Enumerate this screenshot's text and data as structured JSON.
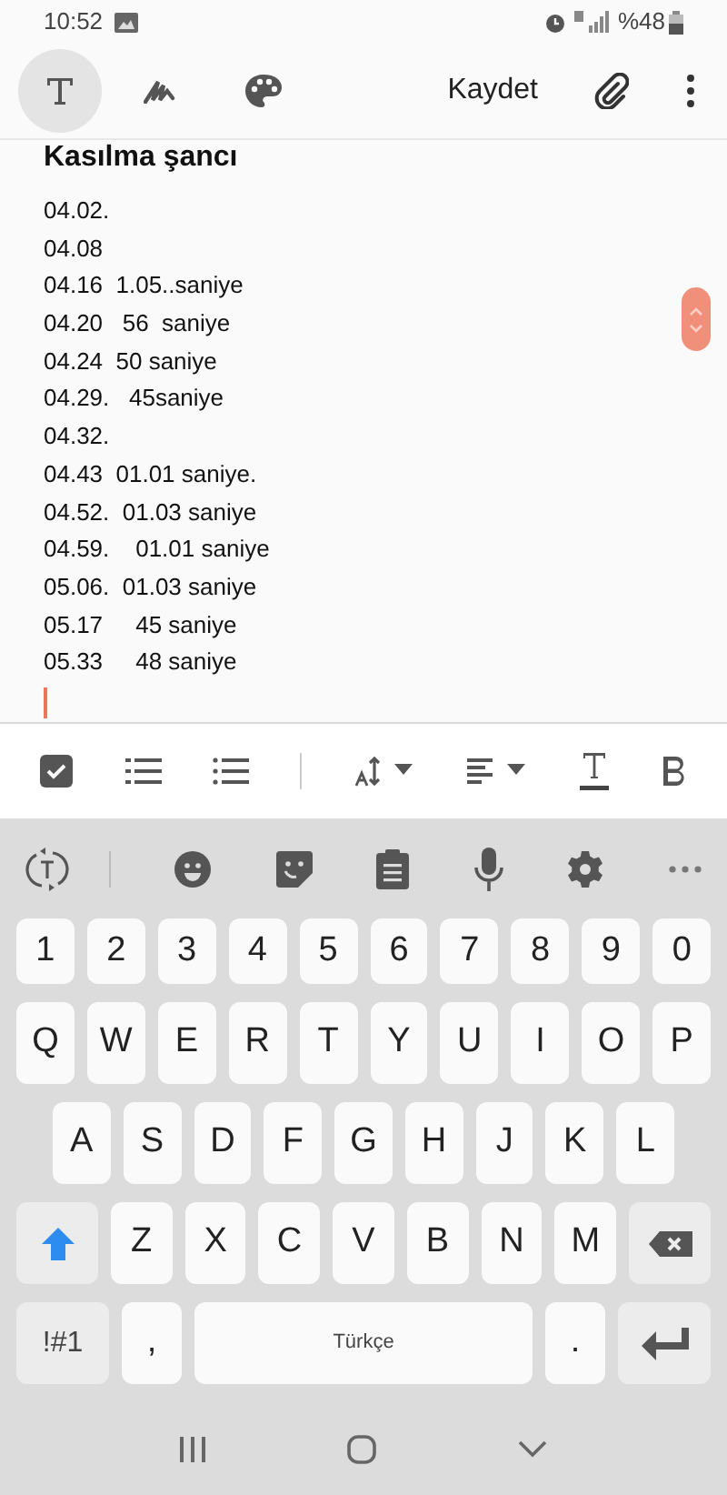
{
  "status_bar": {
    "time": "10:52",
    "battery": "%48"
  },
  "toolbar": {
    "modes": [
      {
        "kind": "text",
        "selected": true
      },
      {
        "kind": "pen",
        "selected": false
      },
      {
        "kind": "palette",
        "selected": false
      }
    ],
    "save": "Kaydet"
  },
  "note": {
    "title": "Kasılma şancı",
    "lines": [
      "04.02.",
      "04.08",
      "04.16  1.05..saniye",
      "04.20   56  saniye",
      "04.24  50 saniye",
      "04.29.   45saniye",
      "04.32.",
      "04.43  01.01 saniye.",
      "04.52.  01.03 saniye",
      "04.59.    01.01 saniye",
      "05.06.  01.03 saniye",
      "05.17     45 saniye",
      "05.33     48 saniye"
    ]
  },
  "keyboard": {
    "rows": [
      [
        {
          "kind": "char",
          "label": "1"
        },
        {
          "kind": "char",
          "label": "2"
        },
        {
          "kind": "char",
          "label": "3"
        },
        {
          "kind": "char",
          "label": "4"
        },
        {
          "kind": "char",
          "label": "5"
        },
        {
          "kind": "char",
          "label": "6"
        },
        {
          "kind": "char",
          "label": "7"
        },
        {
          "kind": "char",
          "label": "8"
        },
        {
          "kind": "char",
          "label": "9"
        },
        {
          "kind": "char",
          "label": "0"
        }
      ],
      [
        {
          "kind": "char",
          "label": "Q"
        },
        {
          "kind": "char",
          "label": "W"
        },
        {
          "kind": "char",
          "label": "E"
        },
        {
          "kind": "char",
          "label": "R"
        },
        {
          "kind": "char",
          "label": "T"
        },
        {
          "kind": "char",
          "label": "Y"
        },
        {
          "kind": "char",
          "label": "U"
        },
        {
          "kind": "char",
          "label": "I"
        },
        {
          "kind": "char",
          "label": "O"
        },
        {
          "kind": "char",
          "label": "P"
        }
      ],
      [
        {
          "kind": "char",
          "label": "A"
        },
        {
          "kind": "char",
          "label": "S"
        },
        {
          "kind": "char",
          "label": "D"
        },
        {
          "kind": "char",
          "label": "F"
        },
        {
          "kind": "char",
          "label": "G"
        },
        {
          "kind": "char",
          "label": "H"
        },
        {
          "kind": "char",
          "label": "J"
        },
        {
          "kind": "char",
          "label": "K"
        },
        {
          "kind": "char",
          "label": "L"
        }
      ],
      [
        {
          "kind": "shift",
          "on": true
        },
        {
          "kind": "char",
          "label": "Z"
        },
        {
          "kind": "char",
          "label": "X"
        },
        {
          "kind": "char",
          "label": "C"
        },
        {
          "kind": "char",
          "label": "V"
        },
        {
          "kind": "char",
          "label": "B"
        },
        {
          "kind": "char",
          "label": "N"
        },
        {
          "kind": "char",
          "label": "M"
        },
        {
          "kind": "backspace"
        }
      ],
      [
        {
          "kind": "symbols",
          "label": "!#1"
        },
        {
          "kind": "char",
          "label": ","
        },
        {
          "kind": "space",
          "label": "Türkçe"
        },
        {
          "kind": "char",
          "label": "."
        },
        {
          "kind": "enter"
        }
      ]
    ]
  }
}
